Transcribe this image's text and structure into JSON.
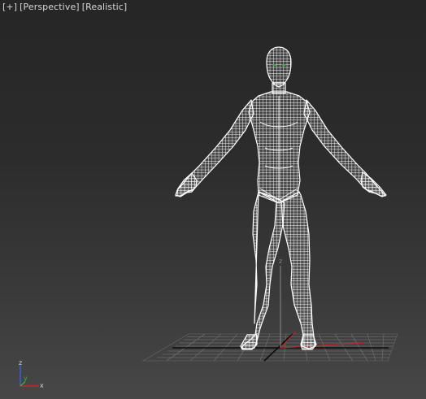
{
  "viewport": {
    "menu_label": "[+]",
    "view_label": "[Perspective]",
    "shading_label": "[Realistic]"
  },
  "gizmo": {
    "z_label": "z",
    "x_label": "x",
    "y_label": "y"
  },
  "pivot": {
    "z_label": "z"
  },
  "colors": {
    "background_top": "#262626",
    "background_bottom": "#474747",
    "wireframe": "#ffffff",
    "grid": "#6a6a6a",
    "x_axis": "#c0262a",
    "y_axis": "#3cb043",
    "z_axis": "#3a63d4"
  },
  "model": {
    "icon": "human-mesh-wireframe",
    "display": "wireframe"
  }
}
